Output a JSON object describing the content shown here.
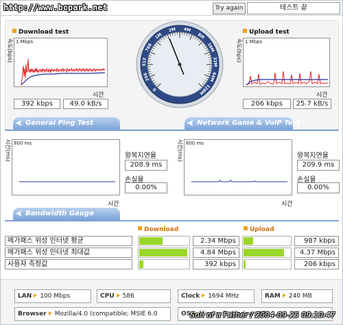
{
  "header": {
    "site": "http://www.bcpark.net",
    "try_again": "Try again",
    "status": "테스트 끝"
  },
  "download": {
    "title": "Download test",
    "y_unit": "속도(bps)",
    "max_label": "1 Mbps",
    "time_label": "시간",
    "speed": "392 kbps",
    "rate": "49.0 kB/s"
  },
  "upload": {
    "title": "Upload test",
    "y_unit": "속도(bps)",
    "max_label": "1 Mbps",
    "time_label": "시간",
    "speed": "206 kbps",
    "rate": "25.7 kB/s"
  },
  "gauge": {
    "labels": [
      "0",
      "256",
      "512",
      "768",
      "1M",
      "2M",
      "4M",
      "8M",
      "16M",
      "32M",
      "64M",
      "128M"
    ],
    "needle_fraction": 0.42
  },
  "tabs": {
    "ping": "General Ping Test",
    "game": "Network Game & VoIP Test",
    "bandwidth": "Bandwidth Gauge"
  },
  "ping_general": {
    "y_unit": "시간(ms)",
    "max_label": "800 ms",
    "time_label": "시간",
    "rtt_label": "왕복지연율",
    "rtt": "208.9 ms",
    "loss_label": "손실율",
    "loss": "0.00%"
  },
  "ping_game": {
    "y_unit": "시간(ms)",
    "max_label": "800 ms",
    "time_label": "시간",
    "rtt_label": "왕복지연율",
    "rtt": "209.9 ms",
    "loss_label": "손실율",
    "loss": "0.00%"
  },
  "bandwidth": {
    "download_header": "Download",
    "upload_header": "Upload",
    "rows": [
      {
        "label": "메가패스 위성 인터넷 평균",
        "down": "2.34 Mbps",
        "down_fill": 0.47,
        "up": "987 kbps",
        "up_fill": 0.2
      },
      {
        "label": "메가패스 위성 인터넷 최대값",
        "down": "4.84 Mbps",
        "down_fill": 0.97,
        "up": "4.37 Mbps",
        "up_fill": 0.87
      },
      {
        "label": "사용자 측정값",
        "down": "392 kbps",
        "down_fill": 0.08,
        "up": "206 kbps",
        "up_fill": 0.04
      }
    ]
  },
  "system": {
    "lan_label": "LAN",
    "lan": "100 Mbps",
    "cpu_label": "CPU",
    "cpu": "586",
    "clock_label": "Clock",
    "clock": "1694 MHz",
    "ram_label": "RAM",
    "ram": "240 MB",
    "browser_label": "Browser",
    "browser": "Mozilla/4.0 (compatible; MSIE 6.0",
    "os_label": "OS",
    "os": "Microsoft Windows XP"
  },
  "signature": "Son of a Father / 2004-09-25 09:10:47",
  "colors": {
    "accent": "#f0a020",
    "tab_blue": "#7ba3d8",
    "bar_green": "#9ad628",
    "graph_red": "#e02020",
    "graph_blue": "#2030a0"
  }
}
